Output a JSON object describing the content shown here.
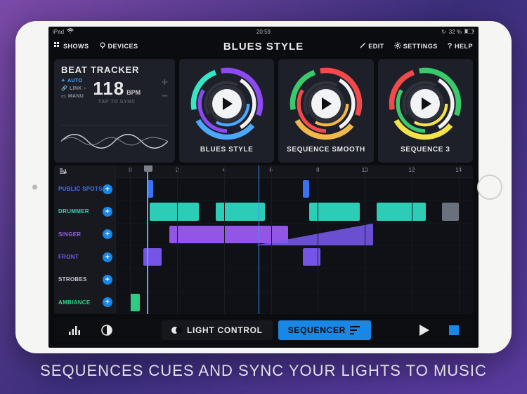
{
  "status": {
    "device": "iPad",
    "wifi": "᯾",
    "time": "20:59",
    "battery_pct": "32 %",
    "battery_icon": "▮"
  },
  "toolbar": {
    "shows_label": "SHOWS",
    "devices_label": "DEVICES",
    "title": "BLUES STYLE",
    "edit_label": "EDIT",
    "settings_label": "SETTINGS",
    "help_label": "HELP"
  },
  "beat_tracker": {
    "title": "BEAT TRACKER",
    "modes": [
      {
        "name": "AUTO",
        "active": true
      },
      {
        "name": "LINK",
        "active": false
      },
      {
        "name": "MANU",
        "active": false
      }
    ],
    "bpm_value": "118",
    "bpm_unit": "BPM",
    "tap_sync": "TAP TO SYNC",
    "plus": "+",
    "minus": "−"
  },
  "sequences": [
    {
      "label": "BLUES STYLE",
      "colors": [
        "#8e4af2",
        "#4aa8ff",
        "#36e6c4",
        "#f2f2f2"
      ]
    },
    {
      "label": "SEQUENCE SMOOTH",
      "colors": [
        "#f24a4a",
        "#f2b94a",
        "#3ac96b",
        "#f2f2f2"
      ]
    },
    {
      "label": "SEQUENCE 3",
      "colors": [
        "#3ac96b",
        "#f2e34a",
        "#f24a4a",
        "#f2f2f2"
      ]
    }
  ],
  "timeline": {
    "ticks": [
      "0",
      "2",
      "4",
      "6",
      "8",
      "10",
      "12",
      "14"
    ],
    "tracks": [
      {
        "name": "PUBLIC SPOTS",
        "color": "#3a79ff"
      },
      {
        "name": "DRUMMER",
        "color": "#2fd7c0"
      },
      {
        "name": "SINGER",
        "color": "#9b5af2"
      },
      {
        "name": "FRONT",
        "color": "#7a5af2"
      },
      {
        "name": "STROBES",
        "color": "#c4c8d2"
      },
      {
        "name": "AMBIANCE",
        "color": "#2fd78b"
      }
    ],
    "clips": [
      {
        "track": 0,
        "start": 0.05,
        "end": 0.07,
        "color": "#3a79ff"
      },
      {
        "track": 0,
        "start": 0.525,
        "end": 0.545,
        "color": "#3a79ff"
      },
      {
        "track": 1,
        "start": 0.06,
        "end": 0.21,
        "color": "#2fd7c0"
      },
      {
        "track": 1,
        "start": 0.26,
        "end": 0.41,
        "color": "#2fd7c0"
      },
      {
        "track": 1,
        "start": 0.545,
        "end": 0.7,
        "color": "#2fd7c0"
      },
      {
        "track": 1,
        "start": 0.75,
        "end": 0.9,
        "color": "#2fd7c0"
      },
      {
        "track": 1,
        "start": 0.95,
        "end": 1.0,
        "color": "#707682"
      },
      {
        "track": 2,
        "start": 0.12,
        "end": 0.48,
        "color": "#9b5af2"
      },
      {
        "track": 2,
        "start": 0.38,
        "end": 0.74,
        "color": "#7a5af2",
        "tri": true
      },
      {
        "track": 3,
        "start": 0.04,
        "end": 0.095,
        "color": "#7a5af2"
      },
      {
        "track": 3,
        "start": 0.525,
        "end": 0.58,
        "color": "#7a5af2"
      },
      {
        "track": 5,
        "start": 0.0,
        "end": 0.03,
        "color": "#2fd78b"
      }
    ],
    "playhead_pos": 0.05,
    "cursor_pos": 0.39
  },
  "bottom_bar": {
    "light_control_label": "LIGHT CONTROL",
    "sequencer_label": "SEQUENCER"
  },
  "caption": "SEQUENCES CUES AND SYNC YOUR LIGHTS TO MUSIC"
}
